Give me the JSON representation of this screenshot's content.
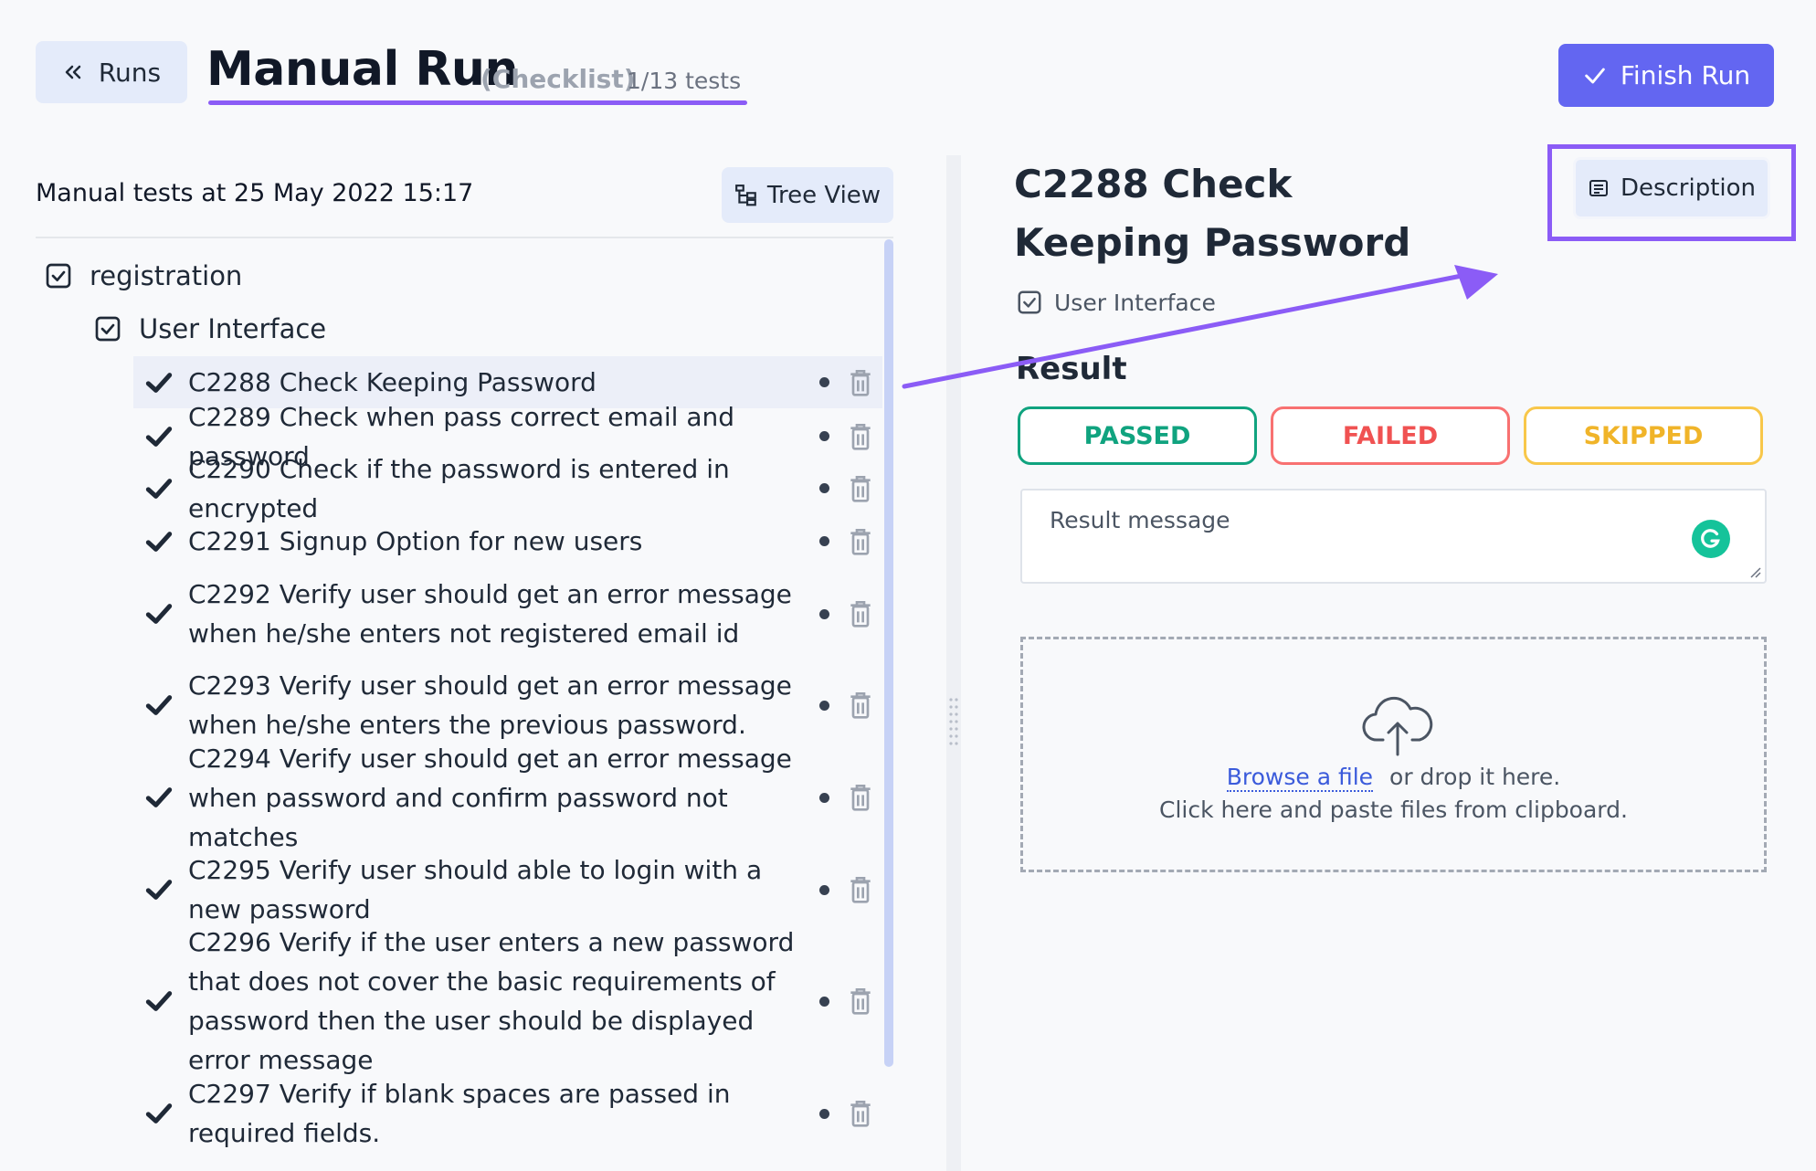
{
  "header": {
    "back_label": "Runs",
    "title": "Manual Run",
    "subtitle": "(Checklist)",
    "count": "1/13 tests",
    "finish_label": "Finish Run"
  },
  "left_panel": {
    "heading": "Manual tests at 25 May 2022 15:17",
    "tree_view_label": "Tree View",
    "suites": [
      {
        "label": "registration"
      },
      {
        "label": "User Interface"
      }
    ],
    "tests": [
      {
        "label": "C2288 Check Keeping Password"
      },
      {
        "label": "C2289 Check when pass correct email and password"
      },
      {
        "label": "C2290 Check if the password is entered in encrypted"
      },
      {
        "label": "C2291 Signup Option for new users"
      },
      {
        "label": "C2292 Verify user should get an error message when he/she enters not registered email id"
      },
      {
        "label": "C2293 Verify user should get an error message when he/she enters the previous password."
      },
      {
        "label": "C2294 Verify user should get an error message when password and confirm password not matches"
      },
      {
        "label": "C2295 Verify user should able to login with a new password"
      },
      {
        "label": "C2296 Verify if the user enters a new password that does not cover the basic requirements of password then the user should be displayed error message"
      },
      {
        "label": "C2297 Verify if blank spaces are passed in required fields."
      }
    ]
  },
  "detail": {
    "title": "C2288 Check Keeping Password",
    "description_label": "Description",
    "suite": "User Interface",
    "result_label": "Result",
    "passed": "PASSED",
    "failed": "FAILED",
    "skipped": "SKIPPED",
    "message_placeholder": "Result message",
    "browse_link": "Browse a file",
    "browse_rest": "or drop it here.",
    "paste_text": "Click here and paste files from clipboard."
  },
  "colors": {
    "accent": "#6366f1",
    "annotation": "#8b5cf6",
    "passed": "#10a37f",
    "failed": "#f05252",
    "skipped": "#f0b429"
  }
}
